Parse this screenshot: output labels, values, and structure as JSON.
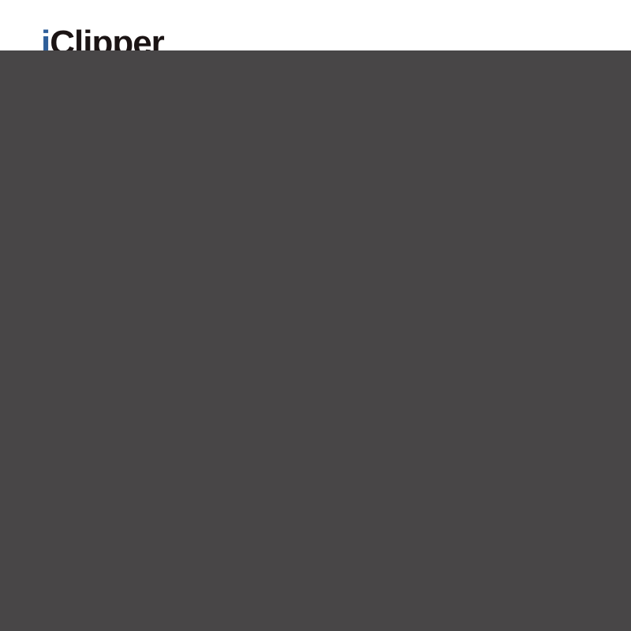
{
  "logo": {
    "prefix": "i",
    "rest": "Clipper",
    "prefix_color": "#2f5f9a",
    "rest_color": "#1b1414"
  },
  "overlay": {
    "color": "#484647"
  }
}
